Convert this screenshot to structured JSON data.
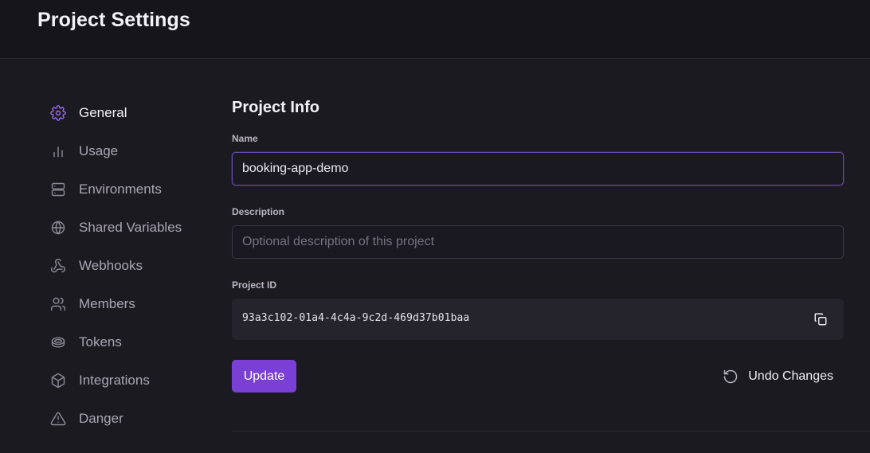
{
  "header": {
    "title": "Project Settings"
  },
  "sidebar": {
    "items": [
      {
        "label": "General",
        "icon": "gear-icon",
        "active": true
      },
      {
        "label": "Usage",
        "icon": "bar-chart-icon"
      },
      {
        "label": "Environments",
        "icon": "server-icon"
      },
      {
        "label": "Shared Variables",
        "icon": "globe-icon"
      },
      {
        "label": "Webhooks",
        "icon": "webhook-icon"
      },
      {
        "label": "Members",
        "icon": "users-icon"
      },
      {
        "label": "Tokens",
        "icon": "token-icon"
      },
      {
        "label": "Integrations",
        "icon": "box-icon"
      },
      {
        "label": "Danger",
        "icon": "warning-icon"
      }
    ]
  },
  "main": {
    "section_title": "Project Info",
    "name": {
      "label": "Name",
      "value": "booking-app-demo"
    },
    "description": {
      "label": "Description",
      "placeholder": "Optional description of this project",
      "value": ""
    },
    "project_id": {
      "label": "Project ID",
      "value": "93a3c102-01a4-4c4a-9c2d-469d37b01baa"
    },
    "update_label": "Update",
    "undo_label": "Undo Changes"
  },
  "colors": {
    "accent": "#7a40d6",
    "active_icon": "#9a6cf0",
    "background": "#1c1a21"
  }
}
